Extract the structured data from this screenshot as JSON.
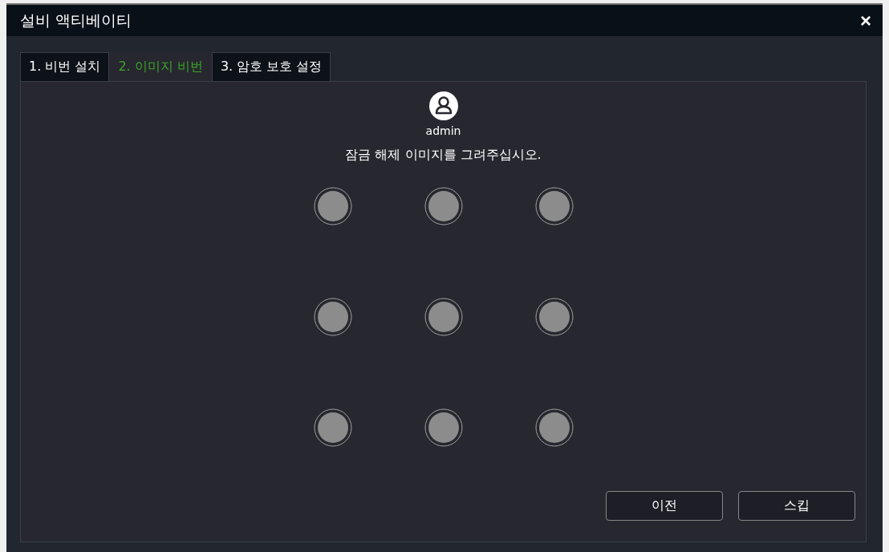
{
  "window": {
    "title": "설비 액티베이티",
    "close": "×"
  },
  "tabs": [
    {
      "label": "1. 비번 설치",
      "selected": false
    },
    {
      "label": "2. 이미지 비번",
      "selected": true
    },
    {
      "label": "3. 암호 보호 설정",
      "selected": false
    }
  ],
  "user": {
    "name": "admin"
  },
  "instruction": "잠금 해제 이미지를 그려주십시오.",
  "buttons": [
    "이전",
    "스킵"
  ]
}
